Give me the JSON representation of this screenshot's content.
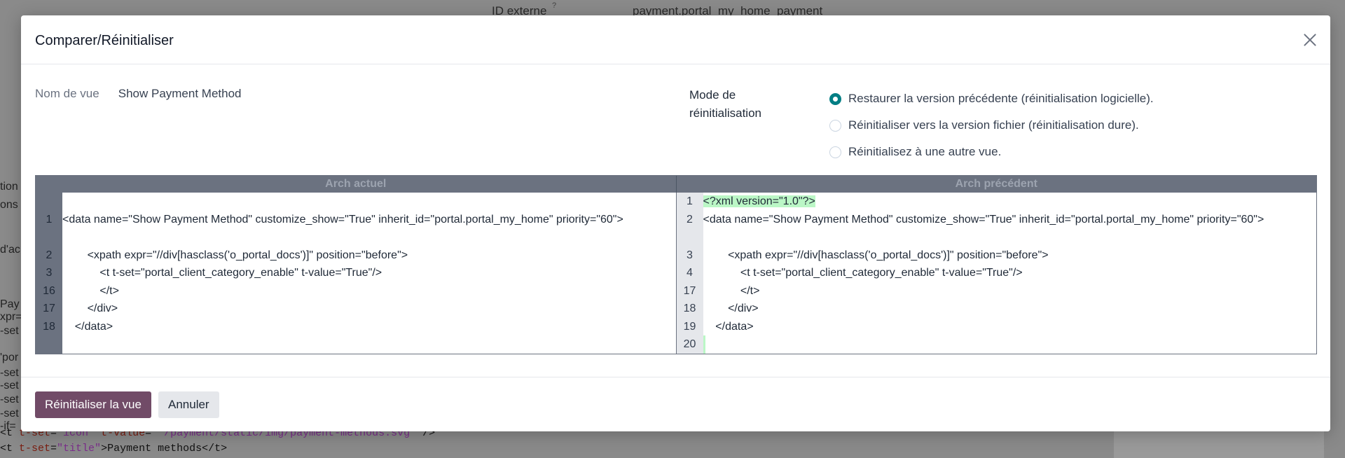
{
  "background": {
    "external_id_label": "ID externe",
    "external_id_hint": "?",
    "external_id_value": "payment.portal_my_home_payment",
    "left_fragments": [
      "tion",
      "ons",
      "d'ac",
      "Pay",
      "xpr=",
      "-set",
      "'por",
      "-set",
      "-set",
      "-set",
      "-set",
      "-if="
    ],
    "code_line_1": {
      "open": "<t ",
      "attr1": "t-set",
      "eq1": "=",
      "val1": "\"icon\"",
      "attr2": " t-value",
      "eq2": "=",
      "val2": "\"'/payment/static/img/payment-methods.svg'\"",
      "close": "/>"
    },
    "code_line_2": {
      "open": "<t ",
      "attr1": "t-set",
      "eq1": "=",
      "val1": "\"title\"",
      "text": ">Payment methods</t>"
    }
  },
  "modal": {
    "title": "Comparer/Réinitialiser",
    "view_name_label": "Nom de vue",
    "view_name_value": "Show Payment Method",
    "reset_mode_label": "Mode de réinitialisation",
    "reset_options": [
      {
        "label": "Restaurer la version précédente (réinitialisation logicielle).",
        "checked": true
      },
      {
        "label": "Réinitialiser vers la version fichier (réinitialisation dure).",
        "checked": false
      },
      {
        "label": "Réinitialisez à une autre vue.",
        "checked": false
      }
    ],
    "diff": {
      "left_title": "Arch actuel",
      "right_title": "Arch précédent",
      "left_lines": [
        {
          "num": "",
          "text": ""
        },
        {
          "num": "1",
          "text": "<data name=\"Show Payment Method\" customize_show=\"True\" inherit_id=\"portal.portal_my_home\" priority=\"60\">",
          "wrap": true
        },
        {
          "num": "2",
          "text": "        <xpath expr=\"//div[hasclass('o_portal_docs')]\" position=\"before\">"
        },
        {
          "num": "3",
          "text": "            <t t-set=\"portal_client_category_enable\" t-value=\"True\"/>"
        },
        {
          "num": "16",
          "text": "            </t>"
        },
        {
          "num": "17",
          "text": "        </div>"
        },
        {
          "num": "18",
          "text": "    </data>"
        }
      ],
      "right_lines": [
        {
          "num": "1",
          "text": "<?xml version=\"1.0\"?>",
          "added": true
        },
        {
          "num": "2",
          "text": "<data name=\"Show Payment Method\" customize_show=\"True\" inherit_id=\"portal.portal_my_home\" priority=\"60\">",
          "wrap": true
        },
        {
          "num": "3",
          "text": "        <xpath expr=\"//div[hasclass('o_portal_docs')]\" position=\"before\">"
        },
        {
          "num": "4",
          "text": "            <t t-set=\"portal_client_category_enable\" t-value=\"True\"/>"
        },
        {
          "num": "17",
          "text": "            </t>"
        },
        {
          "num": "18",
          "text": "        </div>"
        },
        {
          "num": "19",
          "text": "    </data>"
        },
        {
          "num": "20",
          "text": "",
          "added": true
        }
      ]
    },
    "primary_button": "Réinitialiser la vue",
    "secondary_button": "Annuler"
  },
  "colors": {
    "primary": "#714b67",
    "radio_checked": "#017e84",
    "diff_added": "#bbf7c6",
    "diff_header": "#6b7280"
  }
}
